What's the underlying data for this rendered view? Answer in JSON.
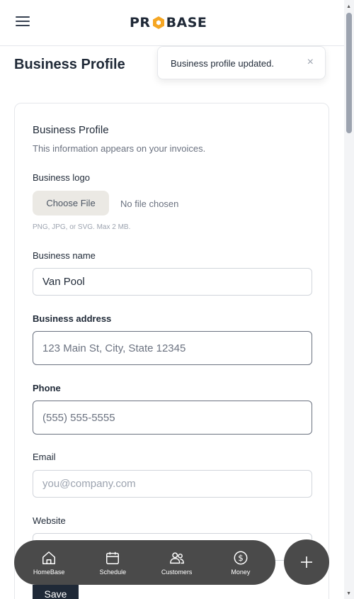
{
  "header": {
    "logo_text_left": "PR",
    "logo_text_right": "BASE"
  },
  "page_title": "Business Profile",
  "toast": {
    "message": "Business profile updated.",
    "close": "×"
  },
  "card": {
    "title": "Business Profile",
    "subtitle": "This information appears on your invoices.",
    "logo": {
      "label": "Business logo",
      "button": "Choose File",
      "status": "No file chosen",
      "hint": "PNG, JPG, or SVG. Max 2 MB."
    },
    "business_name": {
      "label": "Business name",
      "value": "Van Pool"
    },
    "business_address": {
      "label": "Business address",
      "placeholder": "123 Main St, City, State 12345"
    },
    "phone": {
      "label": "Phone",
      "placeholder": "(555) 555-5555"
    },
    "email": {
      "label": "Email",
      "placeholder": "you@company.com"
    },
    "website": {
      "label": "Website",
      "placeholder": ""
    },
    "save_label": "Save"
  },
  "nav": [
    {
      "label": "HomeBase",
      "icon": "home-icon"
    },
    {
      "label": "Schedule",
      "icon": "calendar-icon"
    },
    {
      "label": "Customers",
      "icon": "users-icon"
    },
    {
      "label": "Money",
      "icon": "dollar-icon"
    }
  ],
  "fab": {
    "icon": "plus-icon"
  },
  "colors": {
    "brand_accent": "#f5a623",
    "nav_bg": "#4a4a4a",
    "primary_dark": "#1f2937"
  }
}
